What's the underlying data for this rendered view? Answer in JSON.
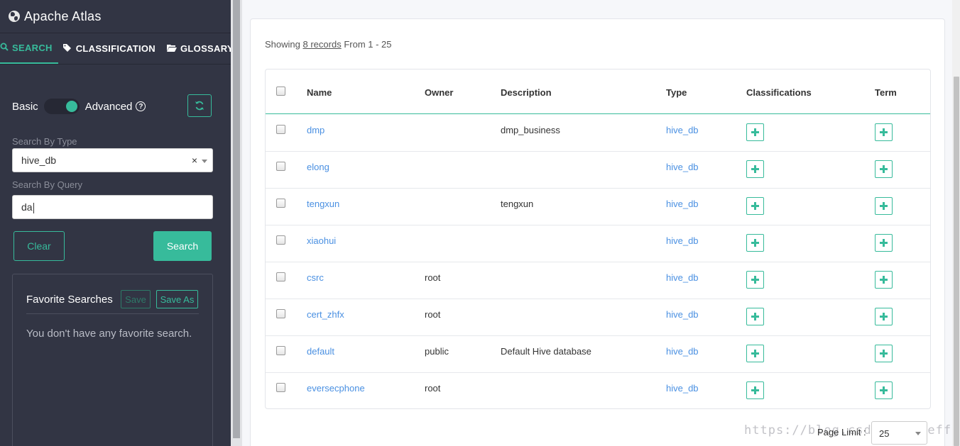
{
  "app": {
    "title": "Apache Atlas"
  },
  "sidebar": {
    "tabs": [
      {
        "label": "SEARCH",
        "icon": "search-icon"
      },
      {
        "label": "CLASSIFICATION",
        "icon": "tags-icon"
      },
      {
        "label": "GLOSSARY",
        "icon": "folder-open-icon"
      }
    ],
    "mode": {
      "basic": "Basic",
      "advanced": "Advanced"
    },
    "search_by_type": {
      "label": "Search By Type",
      "value": "hive_db"
    },
    "search_by_query": {
      "label": "Search By Query",
      "value": "da"
    },
    "buttons": {
      "clear": "Clear",
      "search": "Search"
    },
    "favorites": {
      "title": "Favorite Searches",
      "save": "Save",
      "save_as": "Save As",
      "empty": "You don't have any favorite search."
    }
  },
  "results": {
    "showing_prefix": "Showing",
    "showing_count": "8 records",
    "showing_range": "From 1 - 25",
    "columns": [
      "Name",
      "Owner",
      "Description",
      "Type",
      "Classifications",
      "Term"
    ],
    "rows": [
      {
        "name": "dmp",
        "owner": "",
        "description": "dmp_business",
        "type": "hive_db"
      },
      {
        "name": "elong",
        "owner": "",
        "description": "",
        "type": "hive_db"
      },
      {
        "name": "tengxun",
        "owner": "",
        "description": "tengxun",
        "type": "hive_db"
      },
      {
        "name": "xiaohui",
        "owner": "",
        "description": "",
        "type": "hive_db"
      },
      {
        "name": "csrc",
        "owner": "root",
        "description": "",
        "type": "hive_db"
      },
      {
        "name": "cert_zhfx",
        "owner": "root",
        "description": "",
        "type": "hive_db"
      },
      {
        "name": "default",
        "owner": "public",
        "description": "Default Hive database",
        "type": "hive_db"
      },
      {
        "name": "eversecphone",
        "owner": "root",
        "description": "",
        "type": "hive_db"
      }
    ]
  },
  "pagination": {
    "label": "Page Limit :",
    "value": "25"
  },
  "watermark": "https://blog.csdn.net/jeffiny",
  "colors": {
    "accent": "#37bb9b",
    "sidebar_bg": "#323544",
    "link": "#4a90e2"
  }
}
